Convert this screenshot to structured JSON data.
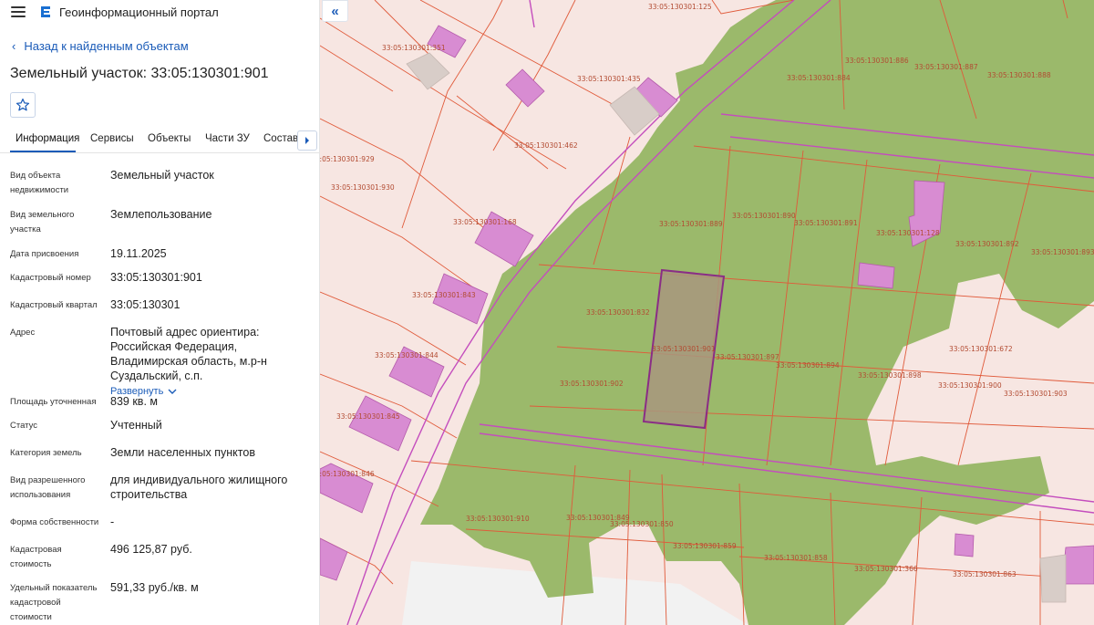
{
  "header": {
    "app_title": "Геоинформационный портал"
  },
  "back_link": "Назад к найденным объектам",
  "page_title": "Земельный участок: 33:05:130301:901",
  "tabs": [
    "Информация",
    "Сервисы",
    "Объекты",
    "Части ЗУ",
    "Состав"
  ],
  "info": {
    "rows": [
      {
        "label": "Вид объекта недвижимости",
        "value": "Земельный участок"
      },
      {
        "label": "Вид земельного участка",
        "value": "Землепользование"
      },
      {
        "label": "Дата присвоения",
        "value": "19.11.2025"
      },
      {
        "label": "Кадастровый номер",
        "value": "33:05:130301:901"
      },
      {
        "label": "Кадастровый квартал",
        "value": "33:05:130301"
      },
      {
        "label": "Адрес",
        "value": "Почтовый адрес ориентира: Российская Федерация, Владимирская область, м.р-н Суздальский, с.п."
      },
      {
        "label": "Площадь уточненная",
        "value": "839 кв. м"
      },
      {
        "label": "Статус",
        "value": "Учтенный"
      },
      {
        "label": "Категория земель",
        "value": "Земли населенных пунктов"
      },
      {
        "label": "Вид разрешенного использования",
        "value": "для индивидуального жилищного строительства"
      },
      {
        "label": "Форма собственности",
        "value": "-"
      },
      {
        "label": "Кадастровая стоимость",
        "value": "496 125,87 руб."
      },
      {
        "label": "Удельный показатель кадастровой стоимости",
        "value": "591,33 руб./кв. м"
      }
    ],
    "expand_label": "Развернуть"
  },
  "map": {
    "parcel_labels": [
      "33:05:130301:125",
      "33:05:130301:351",
      "33:05:130301:435",
      "33:05:130301:462",
      "33:05:130301:886",
      "33:05:130301:887",
      "33:05:130301:888",
      "33:05:130301:884",
      "33:05:130301:929",
      "33:05:130301:930",
      "33:05:130301:168",
      "33:05:130301:889",
      "33:05:130301:890",
      "33:05:130301:891",
      "33:05:130301:128",
      "33:05:130301:892",
      "33:05:130301:893",
      "33:05:130301:843",
      "33:05:130301:832",
      "33:05:130301:844",
      "33:05:130301:901",
      "33:05:130301:897",
      "33:05:130301:894",
      "33:05:130301:898",
      "33:05:130301:672",
      "33:05:130301:902",
      "33:05:130301:900",
      "33:05:130301:903",
      "33:05:130301:845",
      "33:05:130301:846",
      "33:05:130301:910",
      "33:05:130301:849",
      "33:05:130301:850",
      "33:05:130301:859",
      "33:05:130301:858",
      "33:05:130301:366",
      "33:05:130301:863"
    ],
    "colors": {
      "background": "#f7e6e2",
      "green": "#9bb96b",
      "building": "#d88cd2",
      "selected": "#a8967e",
      "boundary": "#e05a3a",
      "road": "#c44dbd"
    }
  }
}
